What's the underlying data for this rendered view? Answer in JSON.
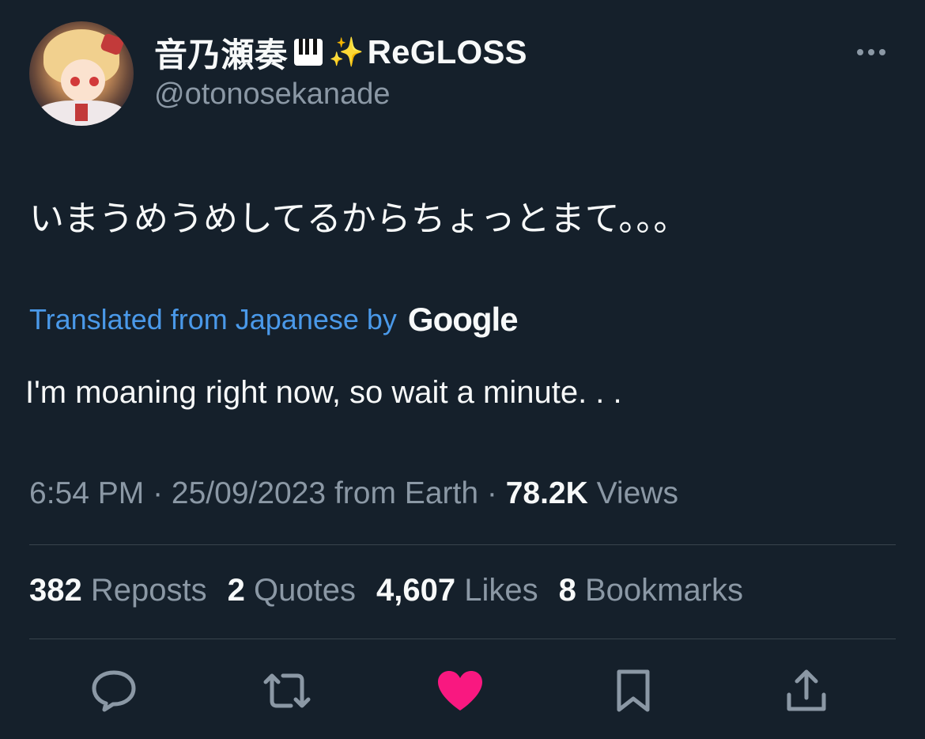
{
  "author": {
    "display_name_prefix": "音乃瀬奏",
    "display_name_suffix": "ReGLOSS",
    "handle": "@otonosekanade"
  },
  "tweet": {
    "text": "いまうめうめしてるからちょっとまて。。。",
    "translated_label": "Translated from Japanese by",
    "translator_brand": "Google",
    "translation": "I'm moaning right now, so wait a minute. . ."
  },
  "meta": {
    "time": "6:54 PM",
    "date": "25/09/2023",
    "source": "from Earth",
    "views_count": "78.2K",
    "views_label": "Views"
  },
  "stats": {
    "reposts_count": "382",
    "reposts_label": "Reposts",
    "quotes_count": "2",
    "quotes_label": "Quotes",
    "likes_count": "4,607",
    "likes_label": "Likes",
    "bookmarks_count": "8",
    "bookmarks_label": "Bookmarks"
  },
  "actions": [
    {
      "name": "reply",
      "icon": "reply-icon"
    },
    {
      "name": "repost",
      "icon": "repost-icon"
    },
    {
      "name": "like",
      "icon": "heart-icon",
      "active": true,
      "color": "#f91880"
    },
    {
      "name": "bookmark",
      "icon": "bookmark-icon"
    },
    {
      "name": "share",
      "icon": "share-icon"
    }
  ],
  "colors": {
    "background": "#15202b",
    "text_primary": "#f7f9f9",
    "text_secondary": "#8b98a5",
    "link": "#4a99e9",
    "like_active": "#f91880",
    "divider": "#38444d"
  }
}
